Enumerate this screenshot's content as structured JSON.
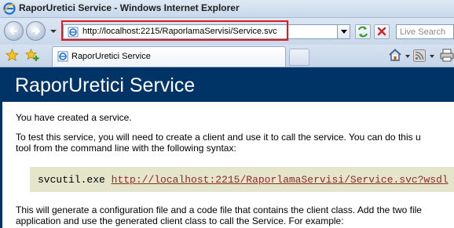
{
  "window": {
    "title": "RaporUretici Service - Windows Internet Explorer"
  },
  "address_bar": {
    "url": "http://localhost:2215/RaporlamaServisi/Service.svc"
  },
  "search": {
    "placeholder": "Live Search"
  },
  "tab": {
    "label": "RaporUretici Service"
  },
  "page": {
    "heading": "RaporUretici Service",
    "para1": "You have created a service.",
    "para2_line1": "To test this service, you will need to create a client and use it to call the service. You can do this u",
    "para2_line2": "tool from the command line with the following syntax:",
    "command": "svcutil.exe",
    "command_link": "http://localhost:2215/RaporlamaServisi/Service.svc?wsdl",
    "para3_line1": "This will generate a configuration file and a code file that contains the client class. Add the two file",
    "para3_line2": "application and use the generated client class to call the Service. For example:"
  },
  "colors": {
    "banner": "#003366",
    "highlight": "#e11b1b",
    "code_bg": "#e5e5cc",
    "link": "#8b2b2b"
  }
}
